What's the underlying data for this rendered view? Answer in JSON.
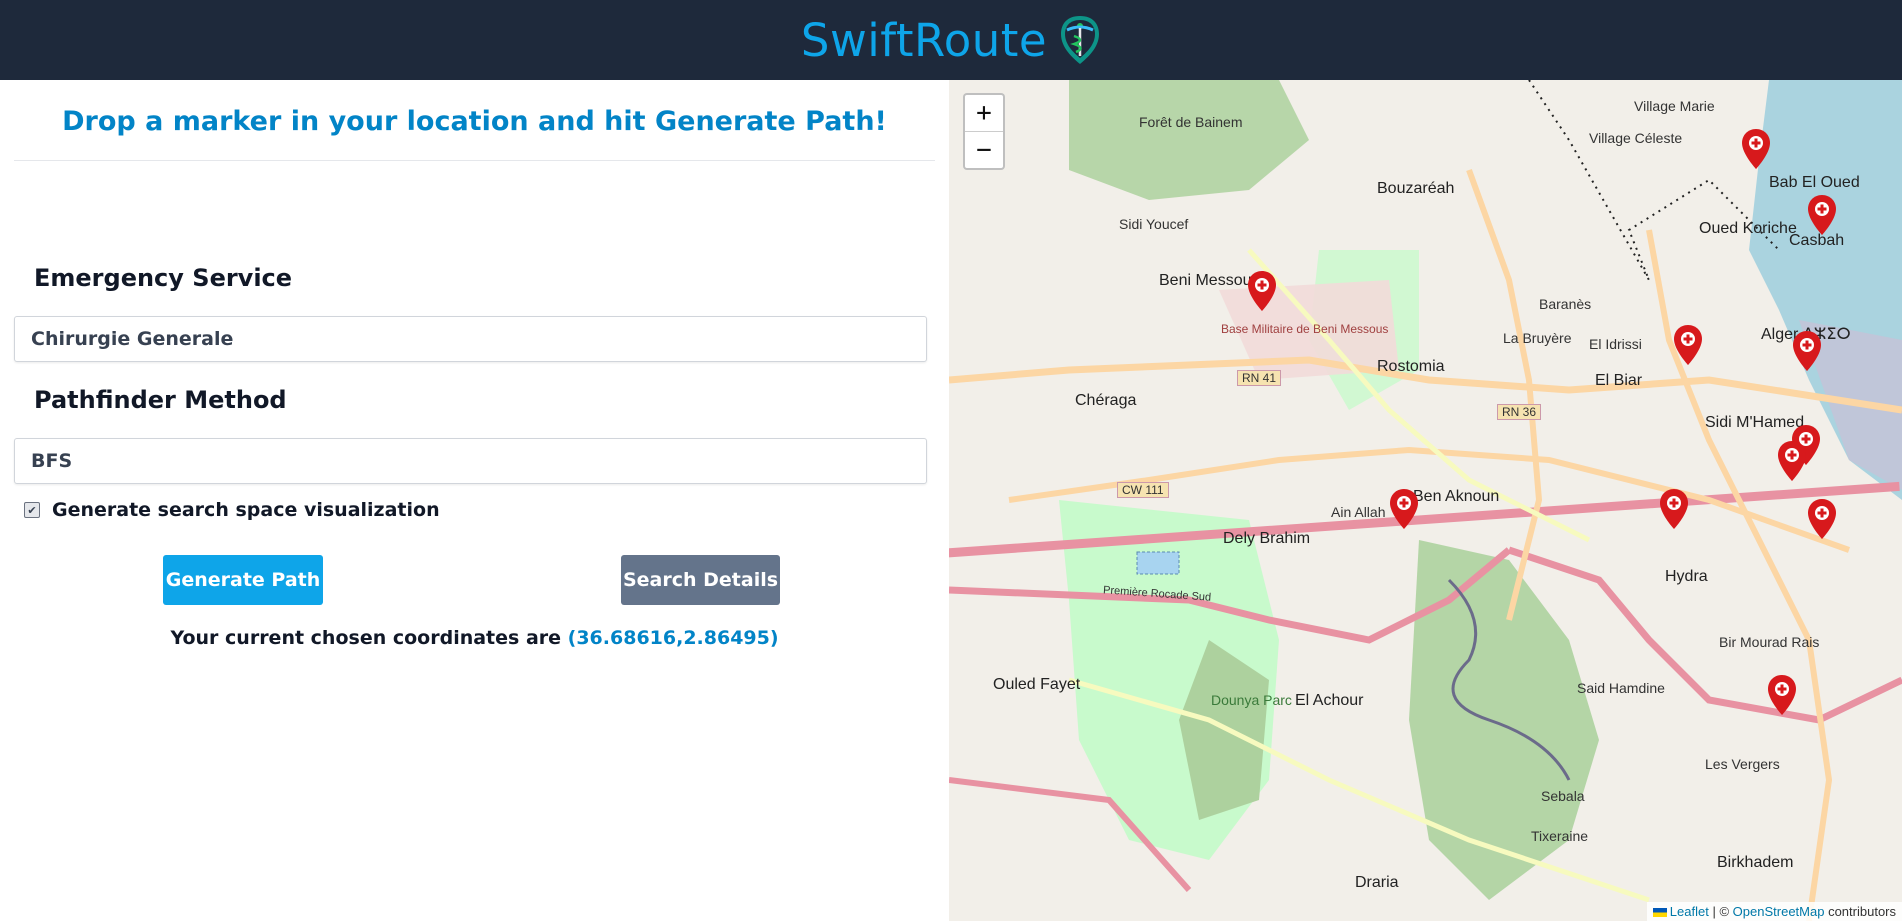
{
  "header": {
    "title": "SwiftRoute",
    "logo_icon": "caduceus-shield-icon"
  },
  "form": {
    "headline": "Drop a marker in your location and hit Generate Path!",
    "service_label": "Emergency Service",
    "service_value": "Chirurgie Generale",
    "method_label": "Pathfinder Method",
    "method_value": "BFS",
    "visualization_label": "Generate search space visualization",
    "visualization_checked": true,
    "generate_button": "Generate Path",
    "details_button": "Search Details",
    "coords_prefix": "Your current chosen coordinates are",
    "coords_value": "(36.68616,2.86495)"
  },
  "map": {
    "zoom_in": "+",
    "zoom_out": "−",
    "attribution": {
      "leaflet": "Leaflet",
      "sep": "| ©",
      "osm": "OpenStreetMap",
      "suffix": "contributors"
    },
    "places": [
      {
        "name": "Village Marie"
      },
      {
        "name": "Village Céleste"
      },
      {
        "name": "Forêt de Bainem"
      },
      {
        "name": "Bouzaréah"
      },
      {
        "name": "Bab El Oued"
      },
      {
        "name": "Oued Koriche"
      },
      {
        "name": "Casbah"
      },
      {
        "name": "Sidi Youcef"
      },
      {
        "name": "Beni Messous"
      },
      {
        "name": "Baranès"
      },
      {
        "name": "La Bruyère"
      },
      {
        "name": "El Idrissi"
      },
      {
        "name": "Alger ⴷⵣⵉⵔ"
      },
      {
        "name": "Rostomia"
      },
      {
        "name": "El Biar"
      },
      {
        "name": "Chéraga"
      },
      {
        "name": "Sidi M'Hamed"
      },
      {
        "name": "Ben Aknoun"
      },
      {
        "name": "Ain Allah"
      },
      {
        "name": "Dely Brahim"
      },
      {
        "name": "Hydra"
      },
      {
        "name": "Bir Mourad Rais"
      },
      {
        "name": "Ouled Fayet"
      },
      {
        "name": "El Achour"
      },
      {
        "name": "Said Hamdine"
      },
      {
        "name": "Les Vergers"
      },
      {
        "name": "Sebala"
      },
      {
        "name": "Tixeraine"
      },
      {
        "name": "Birkhadem"
      },
      {
        "name": "Draria"
      },
      {
        "name": "Dounya Parc"
      },
      {
        "name": "Base Militaire de Beni Messous"
      },
      {
        "name": "RN 41"
      },
      {
        "name": "RN 36"
      },
      {
        "name": "CW 111"
      },
      {
        "name": "Première Rocade Sud"
      }
    ]
  }
}
